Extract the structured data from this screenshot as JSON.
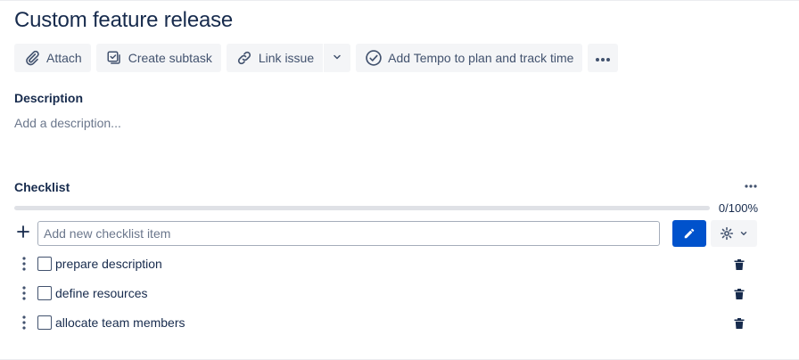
{
  "issue": {
    "title": "Custom feature release"
  },
  "toolbar": {
    "attach": "Attach",
    "create_subtask": "Create subtask",
    "link_issue": "Link issue",
    "add_tempo": "Add Tempo to plan and track time"
  },
  "description": {
    "label": "Description",
    "placeholder": "Add a description..."
  },
  "checklist": {
    "label": "Checklist",
    "progress_text": "0/100%",
    "progress_percent": 0,
    "add_placeholder": "Add new checklist item",
    "items": [
      {
        "label": "prepare description",
        "checked": false
      },
      {
        "label": "define resources",
        "checked": false
      },
      {
        "label": "allocate team members",
        "checked": false
      }
    ]
  },
  "icons": {
    "attach": "paperclip-icon",
    "subtask": "subtask-icon",
    "link": "link-icon",
    "chevron": "chevron-down-icon",
    "tempo": "check-circle-icon",
    "more": "more-icon",
    "plus": "plus-icon",
    "edit": "pencil-icon",
    "settings": "gear-icon",
    "drag": "drag-handle-icon",
    "delete": "trash-icon"
  },
  "colors": {
    "primary": "#0052cc",
    "text": "#172b4d",
    "subtle": "#42526e",
    "button_bg": "#f4f5f7"
  }
}
